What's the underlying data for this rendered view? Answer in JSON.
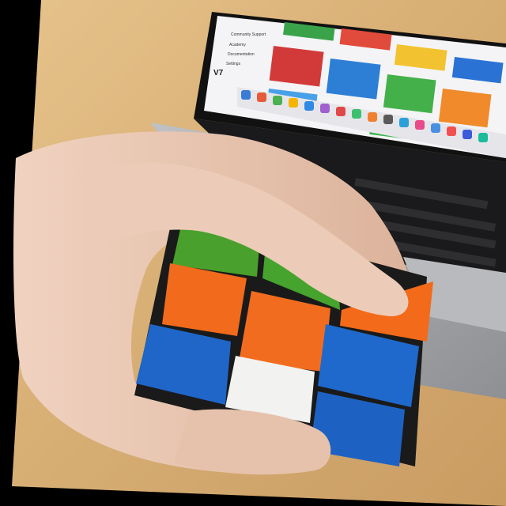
{
  "photo": {
    "subject": "",
    "palette": {
      "background": "#000000",
      "table": "#d9b27a",
      "laptop_body": "#a9abae",
      "screen_bg": "#f4f4f6",
      "keyboard": "#1a1a1c",
      "skin": "#e8c6b2",
      "cube_green": "#4aa02c",
      "cube_orange": "#f26a1b",
      "cube_blue": "#1f66c8",
      "cube_white": "#f2f2f0",
      "cube_body": "#1a1a1a"
    }
  },
  "screen": {
    "brand": "V7",
    "sidebar_items": [
      "Community Support",
      "Academy",
      "Documentation",
      "Settings"
    ]
  },
  "cube": {
    "rows": [
      [
        "green",
        "green"
      ],
      [
        "orange",
        "orange",
        "orange"
      ],
      [
        "blue",
        "white",
        "blue"
      ]
    ]
  }
}
